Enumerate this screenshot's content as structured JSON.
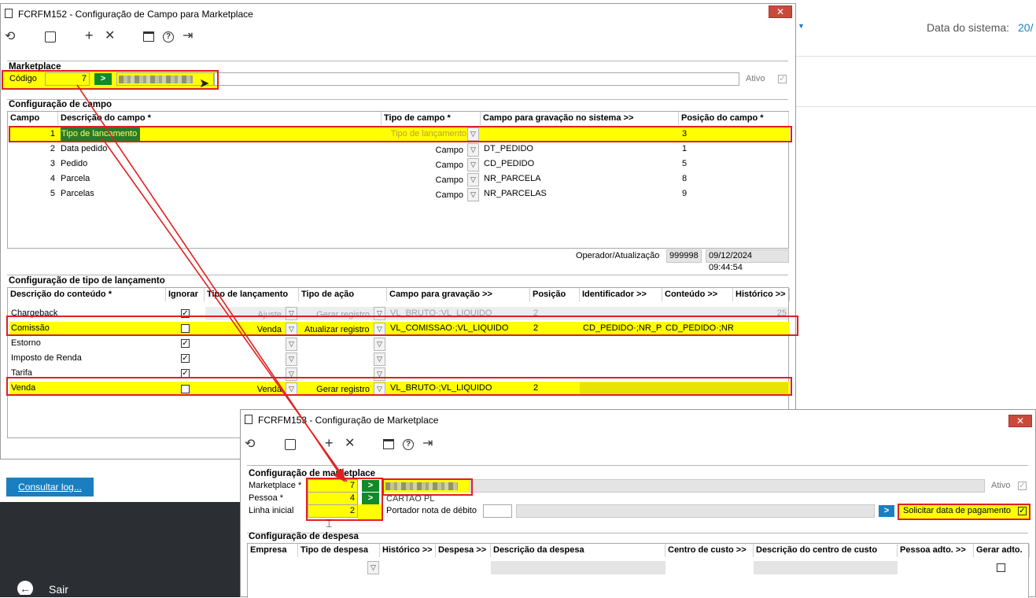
{
  "background_app": {
    "system_date_label": "Data do sistema:",
    "system_date_value": "20/"
  },
  "sidebar": {
    "consultar_log": "Consultar log...",
    "sair": "Sair"
  },
  "win1": {
    "title": "FCRFM152 - Configuração de Campo para Marketplace",
    "close": "✕",
    "marketplace": {
      "section": "Marketplace",
      "codigo_label": "Código",
      "codigo_value": "7",
      "ativo_label": "Ativo"
    },
    "config_campo": {
      "section": "Configuração de campo",
      "headers": [
        "Campo",
        "Descrição do campo *",
        "Tipo de campo *",
        "Campo para gravação no sistema >>",
        "Posição do campo *"
      ],
      "rows": [
        {
          "campo": "1",
          "descricao": "Tipo de lancamento",
          "tipo": "Tipo de lançamento",
          "gravacao": "",
          "posicao": "3"
        },
        {
          "campo": "2",
          "descricao": "Data pedido",
          "tipo": "Campo",
          "gravacao": "DT_PEDIDO",
          "posicao": "1"
        },
        {
          "campo": "3",
          "descricao": "Pedido",
          "tipo": "Campo",
          "gravacao": "CD_PEDIDO",
          "posicao": "5"
        },
        {
          "campo": "4",
          "descricao": "Parcela",
          "tipo": "Campo",
          "gravacao": "NR_PARCELA",
          "posicao": "8"
        },
        {
          "campo": "5",
          "descricao": "Parcelas",
          "tipo": "Campo",
          "gravacao": "NR_PARCELAS",
          "posicao": "9"
        }
      ],
      "operador_label": "Operador/Atualização",
      "operador_value": "999998",
      "atualizacao_value": "09/12/2024 09:44:54"
    },
    "config_tipo": {
      "section": "Configuração de tipo de lançamento",
      "headers": [
        "Descrição do conteúdo *",
        "Ignorar",
        "Tipo de lançamento",
        "Tipo de ação",
        "Campo para gravação >>",
        "Posição",
        "Identificador >>",
        "Conteúdo >>",
        "Histórico >>"
      ],
      "rows": [
        {
          "descricao": "Chargeback",
          "ignorar": true,
          "tipo": "Ajuste",
          "acao": "Gerar registro",
          "gravacao": "VL_BRUTO·;VL_LIQUIDO",
          "posicao": "2",
          "identificador": "",
          "conteudo": "",
          "historico": "25"
        },
        {
          "descricao": "Comissão",
          "ignorar": false,
          "tipo": "Venda",
          "acao": "Atualizar registro",
          "gravacao": "VL_COMISSAO·;VL_LIQUIDO",
          "posicao": "2",
          "identificador": "CD_PEDIDO·;NR_PAR",
          "conteudo": "CD_PEDIDO·;NR_P",
          "historico": ""
        },
        {
          "descricao": "Estorno",
          "ignorar": true,
          "tipo": "",
          "acao": "",
          "gravacao": "",
          "posicao": "",
          "identificador": "",
          "conteudo": "",
          "historico": ""
        },
        {
          "descricao": "Imposto de Renda",
          "ignorar": true,
          "tipo": "",
          "acao": "",
          "gravacao": "",
          "posicao": "",
          "identificador": "",
          "conteudo": "",
          "historico": ""
        },
        {
          "descricao": "Tarifa",
          "ignorar": true,
          "tipo": "",
          "acao": "",
          "gravacao": "",
          "posicao": "",
          "identificador": "",
          "conteudo": "",
          "historico": ""
        },
        {
          "descricao": "Venda",
          "ignorar": false,
          "tipo": "Venda",
          "acao": "Gerar registro",
          "gravacao": "VL_BRUTO·;VL_LIQUIDO",
          "posicao": "2",
          "identificador": "",
          "conteudo": "",
          "historico": ""
        }
      ]
    }
  },
  "win2": {
    "title": "FCRFM153 - Configuração de Marketplace",
    "close": "✕",
    "config_marketplace": {
      "section": "Configuração de marketplace",
      "marketplace_label": "Marketplace *",
      "marketplace_value": "7",
      "pessoa_label": "Pessoa *",
      "pessoa_value": "4",
      "pessoa_name": "CARTAO PL",
      "linha_label": "Linha inicial",
      "linha_value": "2",
      "portador_label": "Portador nota de débito",
      "solicitar_label": "Solicitar data de pagamento",
      "ativo_label": "Ativo"
    },
    "config_despesa": {
      "section": "Configuração de despesa",
      "headers": [
        "Empresa",
        "Tipo de despesa",
        "Histórico >>",
        "Despesa >>",
        "Descrição da despesa",
        "Centro de custo >>",
        "Descrição do centro de custo",
        "Pessoa adto. >>",
        "Gerar adto."
      ]
    }
  },
  "colors": {
    "highlight": "#ffff00",
    "annotation": "#e02020",
    "go_button": "#118a2a",
    "action_blue": "#1a7fc0",
    "close_button": "#c94a3a",
    "sidebar_dark": "#2b2f33"
  }
}
